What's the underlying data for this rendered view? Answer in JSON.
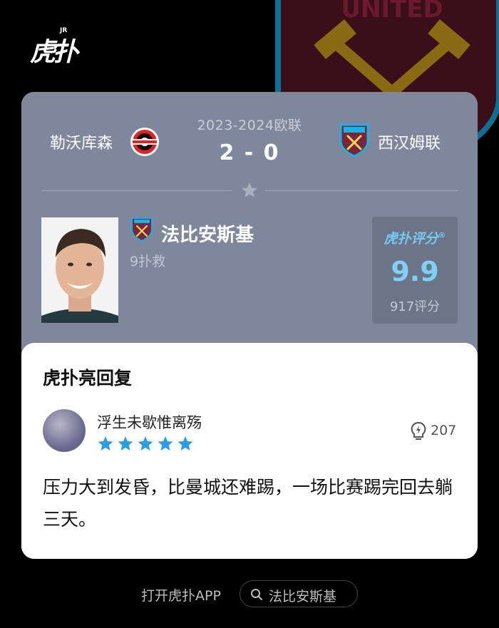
{
  "app": {
    "logo_text": "虎扑",
    "logo_badge": "JR"
  },
  "background": {
    "crest_text": "UNITED"
  },
  "match": {
    "league": "2023-2024欧联",
    "score": "2 - 0",
    "home_team": "勒沃库森",
    "away_team": "西汉姆联"
  },
  "player": {
    "name": "法比安斯基",
    "stat": "9扑救",
    "rating_brand": "虎扑评分",
    "rating_mark": "®",
    "rating_score": "9.9",
    "rating_count": "917评分"
  },
  "reply_section": {
    "title": "虎扑亮回复",
    "username": "浮生未歇惟离殇",
    "stars": 5,
    "likes": "207",
    "comment": "压力大到发昏，比曼城还难踢，一场比赛踢完回去躺三天。"
  },
  "footer": {
    "open_app": "打开虎扑APP",
    "search_text": "法比安斯基"
  },
  "colors": {
    "card_top": "#7e879c",
    "rating_accent": "#7fd0f5",
    "star": "#2a9de6",
    "westham_claret": "#7a263a",
    "westham_blue": "#1bb1e7"
  }
}
